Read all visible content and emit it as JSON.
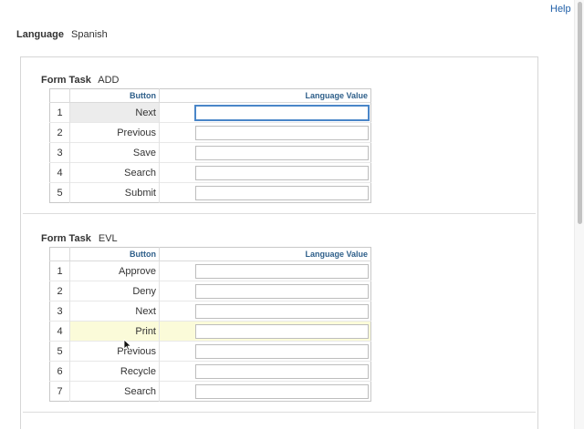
{
  "help": {
    "label": "Help"
  },
  "language": {
    "label": "Language",
    "value": "Spanish"
  },
  "tasks": [
    {
      "label": "Form Task",
      "value": "ADD",
      "columns": {
        "button": "Button",
        "language_value": "Language Value"
      },
      "rows": [
        {
          "num": "1",
          "button": "Next",
          "value": ""
        },
        {
          "num": "2",
          "button": "Previous",
          "value": ""
        },
        {
          "num": "3",
          "button": "Save",
          "value": ""
        },
        {
          "num": "4",
          "button": "Search",
          "value": ""
        },
        {
          "num": "5",
          "button": "Submit",
          "value": ""
        }
      ]
    },
    {
      "label": "Form Task",
      "value": "EVL",
      "columns": {
        "button": "Button",
        "language_value": "Language Value"
      },
      "rows": [
        {
          "num": "1",
          "button": "Approve",
          "value": ""
        },
        {
          "num": "2",
          "button": "Deny",
          "value": ""
        },
        {
          "num": "3",
          "button": "Next",
          "value": ""
        },
        {
          "num": "4",
          "button": "Print",
          "value": ""
        },
        {
          "num": "5",
          "button": "Previous",
          "value": ""
        },
        {
          "num": "6",
          "button": "Recycle",
          "value": ""
        },
        {
          "num": "7",
          "button": "Search",
          "value": ""
        }
      ]
    }
  ],
  "colors": {
    "link": "#1f5fa8",
    "header_text": "#2e5f8a",
    "focus_border": "#4a86c8",
    "hover_row": "#fbfbd9",
    "selected_cell": "#ececec"
  }
}
